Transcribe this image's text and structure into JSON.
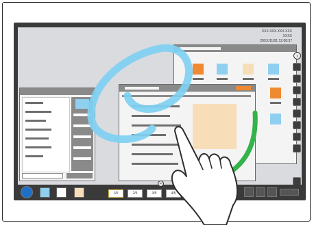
{
  "screen": {
    "info": {
      "address": "XXX.XXX.XXX.XXX",
      "name": "XXXX",
      "datetime": "20XX/11/01 12:08:37"
    }
  },
  "toolbar": {
    "pages": [
      {
        "label": "1/5",
        "active": true
      },
      {
        "label": "2/5",
        "active": false
      },
      {
        "label": "3/5",
        "active": false
      },
      {
        "label": "4/5",
        "active": false
      }
    ]
  },
  "colors": {
    "orange": "#f08a32",
    "light_blue": "#8fd0f0",
    "cream": "#f8ddb9",
    "stroke_blue": "#7fd0f2",
    "arrow_green": "#33b34a",
    "pen_blue": "#1f6fc6"
  },
  "icons": {
    "chevron_right": "chevron-right-icon",
    "chevron_down": "chevron-down-icon",
    "hand": "hand-pointer-icon"
  }
}
